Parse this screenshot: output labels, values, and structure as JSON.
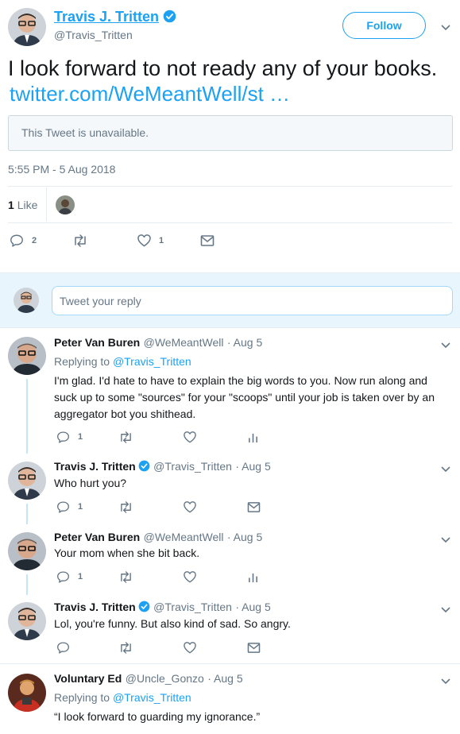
{
  "main_tweet": {
    "name": "Travis J. Tritten",
    "handle": "@Travis_Tritten",
    "follow_label": "Follow",
    "text": "I look forward to not ready any of your books.",
    "link": "twitter.com/WeMeantWell/st …",
    "quoted_unavailable": "This Tweet is unavailable.",
    "timestamp": "5:55 PM - 5 Aug 2018",
    "likes_count": "1",
    "likes_label": "Like",
    "reply_count": "2",
    "like_action_count": "1"
  },
  "reply_box": {
    "placeholder": "Tweet your reply"
  },
  "replies": [
    {
      "name": "Peter Van Buren",
      "handle": "@WeMeantWell",
      "date": "· Aug 5",
      "replying_to_label": "Replying to",
      "replying_to_handle": "@Travis_Tritten",
      "text": "I'm glad. I'd hate to have to explain the big words to you. Now run along and suck up to some \"sources\" for your \"scoops\" until your job is taken over by an aggregator bot you shithead.",
      "reply_count": "1"
    },
    {
      "name": "Travis J. Tritten",
      "handle": "@Travis_Tritten",
      "date": "· Aug 5",
      "text": "Who hurt you?",
      "reply_count": "1"
    },
    {
      "name": "Peter Van Buren",
      "handle": "@WeMeantWell",
      "date": "· Aug 5",
      "text": "Your mom when she bit back.",
      "reply_count": "1"
    },
    {
      "name": "Travis J. Tritten",
      "handle": "@Travis_Tritten",
      "date": "· Aug 5",
      "text": "Lol, you're funny. But also kind of sad. So angry.",
      "reply_count": ""
    },
    {
      "name": "Voluntary Ed",
      "handle": "@Uncle_Gonzo",
      "date": "· Aug 5",
      "replying_to_label": "Replying to",
      "replying_to_handle": "@Travis_Tritten",
      "text": "“I look forward to guarding my ignorance.”"
    }
  ],
  "icons": {
    "verified": "verified-badge-icon",
    "reply": "reply-icon",
    "retweet": "retweet-icon",
    "like": "heart-icon",
    "dm": "envelope-icon",
    "analytics": "analytics-icon",
    "caret": "chevron-down-icon"
  },
  "colors": {
    "accent": "#1da1f2",
    "text": "#14171a",
    "secondary": "#657786",
    "divider": "#e6ecf0",
    "reply_bg": "#f5f8fa",
    "thread_line": "#c4e6fc"
  }
}
